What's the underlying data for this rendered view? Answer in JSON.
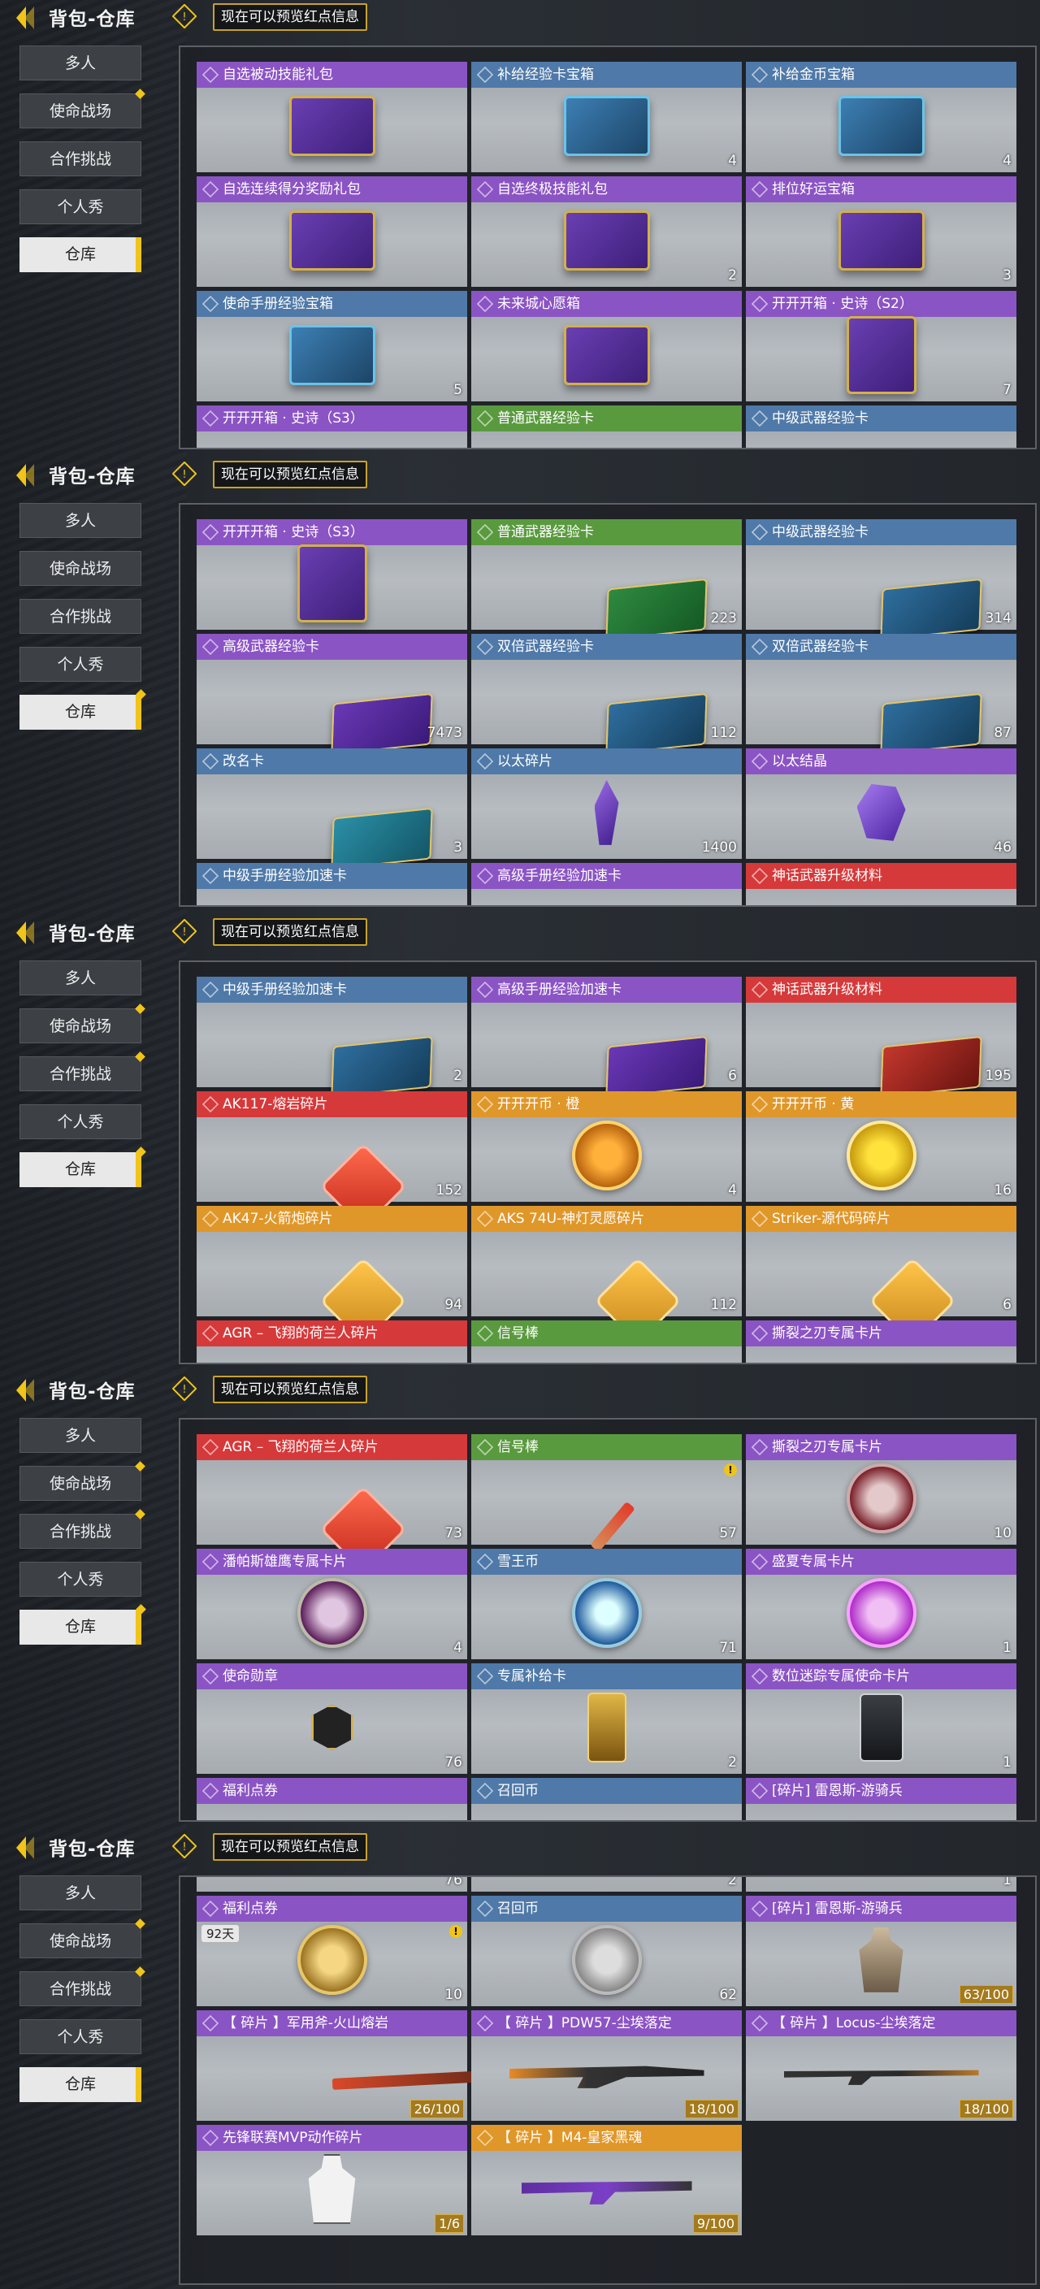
{
  "header": {
    "title": "背包-仓库",
    "notice": "现在可以预览红点信息"
  },
  "tabs": [
    "多人",
    "使命战场",
    "合作挑战",
    "个人秀",
    "仓库"
  ],
  "items": {
    "a1": {
      "label": "自选被动技能礼包",
      "color": "purple",
      "icon": "purple-crate",
      "count": ""
    },
    "a2": {
      "label": "补给经验卡宝箱",
      "color": "blue",
      "icon": "blue-crate",
      "count": "4"
    },
    "a3": {
      "label": "补给金币宝箱",
      "color": "blue",
      "icon": "blue-crate",
      "count": "4"
    },
    "a4": {
      "label": "自选连续得分奖励礼包",
      "color": "purple",
      "icon": "purple-crate",
      "count": ""
    },
    "a5": {
      "label": "自选终极技能礼包",
      "color": "purple",
      "icon": "purple-crate",
      "count": "2"
    },
    "a6": {
      "label": "排位好运宝箱",
      "color": "purple",
      "icon": "purple-crate",
      "count": "3"
    },
    "a7": {
      "label": "使命手册经验宝箱",
      "color": "blue",
      "icon": "blue-crate",
      "count": "5"
    },
    "a8": {
      "label": "未来城心愿箱",
      "color": "purple",
      "icon": "purple-crate",
      "count": ""
    },
    "a9": {
      "label": "开开开箱 · 史诗（S2）",
      "color": "purple",
      "icon": "epic-box",
      "count": "7"
    },
    "b1": {
      "label": "开开开箱 · 史诗（S3）",
      "color": "purple",
      "icon": "epic-box",
      "count": ""
    },
    "b2": {
      "label": "普通武器经验卡",
      "color": "green",
      "icon": "green-xp-card",
      "count": "223"
    },
    "b3": {
      "label": "中级武器经验卡",
      "color": "blue",
      "icon": "blue-xp-card",
      "count": "314"
    },
    "b4": {
      "label": "高级武器经验卡",
      "color": "purple",
      "icon": "purple-xp-card",
      "count": "7473"
    },
    "b5": {
      "label": "双倍武器经验卡",
      "color": "blue",
      "icon": "blue-xp-card",
      "count": "112"
    },
    "b6": {
      "label": "双倍武器经验卡",
      "color": "blue",
      "icon": "blue-xp-card",
      "count": "87"
    },
    "b7": {
      "label": "改名卡",
      "color": "blue",
      "icon": "rename-card",
      "count": "3"
    },
    "b8": {
      "label": "以太碎片",
      "color": "blue",
      "icon": "ether-shard",
      "count": "1400"
    },
    "b9": {
      "label": "以太结晶",
      "color": "purple",
      "icon": "ether-crystal",
      "count": "46"
    },
    "c1": {
      "label": "中级手册经验加速卡",
      "color": "blue",
      "icon": "blue-xp-card",
      "count": "2"
    },
    "c2": {
      "label": "高级手册经验加速卡",
      "color": "purple",
      "icon": "purple-xp-card",
      "count": "6"
    },
    "c3": {
      "label": "神话武器升级材料",
      "color": "red",
      "icon": "red-material-card",
      "count": "195"
    },
    "c4": {
      "label": "AK117-熔岩碎片",
      "color": "red",
      "icon": "red-puzzle",
      "count": "152"
    },
    "c5": {
      "label": "开开开币 · 橙",
      "color": "orange",
      "icon": "orange-coin",
      "count": "4"
    },
    "c6": {
      "label": "开开开币 · 黄",
      "color": "orange",
      "icon": "yellow-coin",
      "count": "16"
    },
    "c7": {
      "label": "AK47-火箭炮碎片",
      "color": "orange",
      "icon": "orange-puzzle",
      "count": "94"
    },
    "c8": {
      "label": "AKS 74U-神灯灵愿碎片",
      "color": "orange",
      "icon": "orange-puzzle",
      "count": "112"
    },
    "c9": {
      "label": "Striker-源代码碎片",
      "color": "orange",
      "icon": "orange-puzzle",
      "count": "6"
    },
    "d1": {
      "label": "AGR – 飞翔的荷兰人碎片",
      "color": "red",
      "icon": "red-puzzle",
      "count": "73"
    },
    "d2": {
      "label": "信号棒",
      "color": "green",
      "icon": "flare",
      "count": "57"
    },
    "d3": {
      "label": "撕裂之刃专属卡片",
      "color": "purple",
      "icon": "red-token",
      "count": "10"
    },
    "d4": {
      "label": "潘帕斯雄鹰专属卡片",
      "color": "purple",
      "icon": "pink-token",
      "count": "4"
    },
    "d5": {
      "label": "雪王币",
      "color": "blue",
      "icon": "snow-coin",
      "count": "71"
    },
    "d6": {
      "label": "盛夏专属卡片",
      "color": "purple",
      "icon": "magenta-token",
      "count": "1"
    },
    "d7": {
      "label": "使命勋章",
      "color": "purple",
      "icon": "medal-hex",
      "count": "76"
    },
    "d8": {
      "label": "专属补给卡",
      "color": "blue",
      "icon": "gold-ticket",
      "count": "2"
    },
    "d9": {
      "label": "数位迷踪专属使命卡片",
      "color": "purple",
      "icon": "black-card",
      "count": "1"
    },
    "e1": {
      "label": "福利点券",
      "color": "purple",
      "icon": "gold-coin",
      "count": "10",
      "days": "92天"
    },
    "e2": {
      "label": "召回币",
      "color": "blue",
      "icon": "grey-coin",
      "count": "62"
    },
    "e3": {
      "label": "[碎片] 雷恩斯-游骑兵",
      "color": "purple",
      "icon": "soldier",
      "count": "63/100"
    },
    "e4": {
      "label": "【 碎片 】军用斧-火山熔岩",
      "color": "purple",
      "icon": "axe",
      "count": "26/100"
    },
    "e5": {
      "label": "【 碎片 】PDW57-尘埃落定",
      "color": "purple",
      "icon": "smg",
      "count": "18/100"
    },
    "e6": {
      "label": "【 碎片 】Locus-尘埃落定",
      "color": "purple",
      "icon": "sniper",
      "count": "18/100"
    },
    "e7": {
      "label": "先锋联赛MVP动作碎片",
      "color": "purple",
      "icon": "mvp-figure",
      "count": "1/6"
    },
    "e8": {
      "label": "【 碎片 】M4-皇家黑魂",
      "color": "orange",
      "icon": "rifle",
      "count": "9/100"
    }
  },
  "partial": {
    "p1a": "开开开箱 · 史诗（S3）",
    "p1b": "普通武器经验卡",
    "p1c": "中级武器经验卡",
    "p2a": "中级手册经验加速卡",
    "p2b": "高级手册经验加速卡",
    "p2c": "神话武器升级材料",
    "p3a": "AGR – 飞翔的荷兰人碎片",
    "p3b": "信号棒",
    "p3c": "撕裂之刃专属卡片",
    "p4a": "福利点券",
    "p4b": "召回币",
    "p4c": "[碎片] 雷恩斯-游骑兵",
    "p5a": "76",
    "p5b": "2",
    "p5c": "1"
  }
}
